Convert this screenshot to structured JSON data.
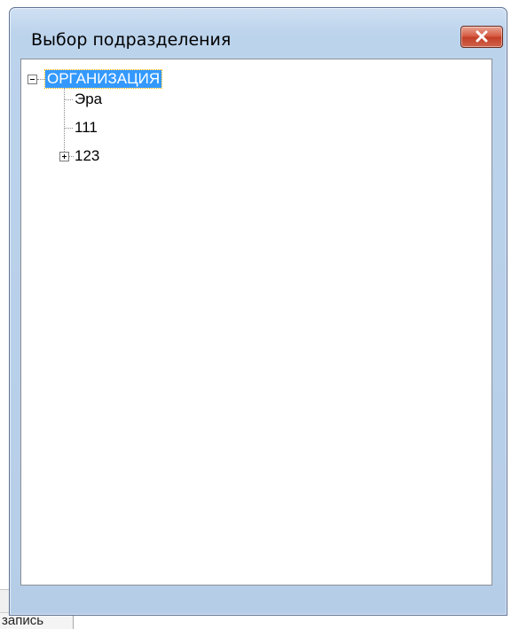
{
  "window": {
    "title": "Выбор подразделения"
  },
  "tree": {
    "root": {
      "label": "ОРГАНИЗАЦИЯ",
      "expanded": true,
      "selected": true
    },
    "children": [
      {
        "label": "Эра",
        "has_children": false
      },
      {
        "label": "111",
        "has_children": false
      },
      {
        "label": "123",
        "has_children": true,
        "expanded": false
      }
    ]
  },
  "background": {
    "partial_label": "запись"
  },
  "colors": {
    "selection": "#3399ff",
    "close_button": "#c9452c",
    "frame": "#bcd3ec"
  }
}
